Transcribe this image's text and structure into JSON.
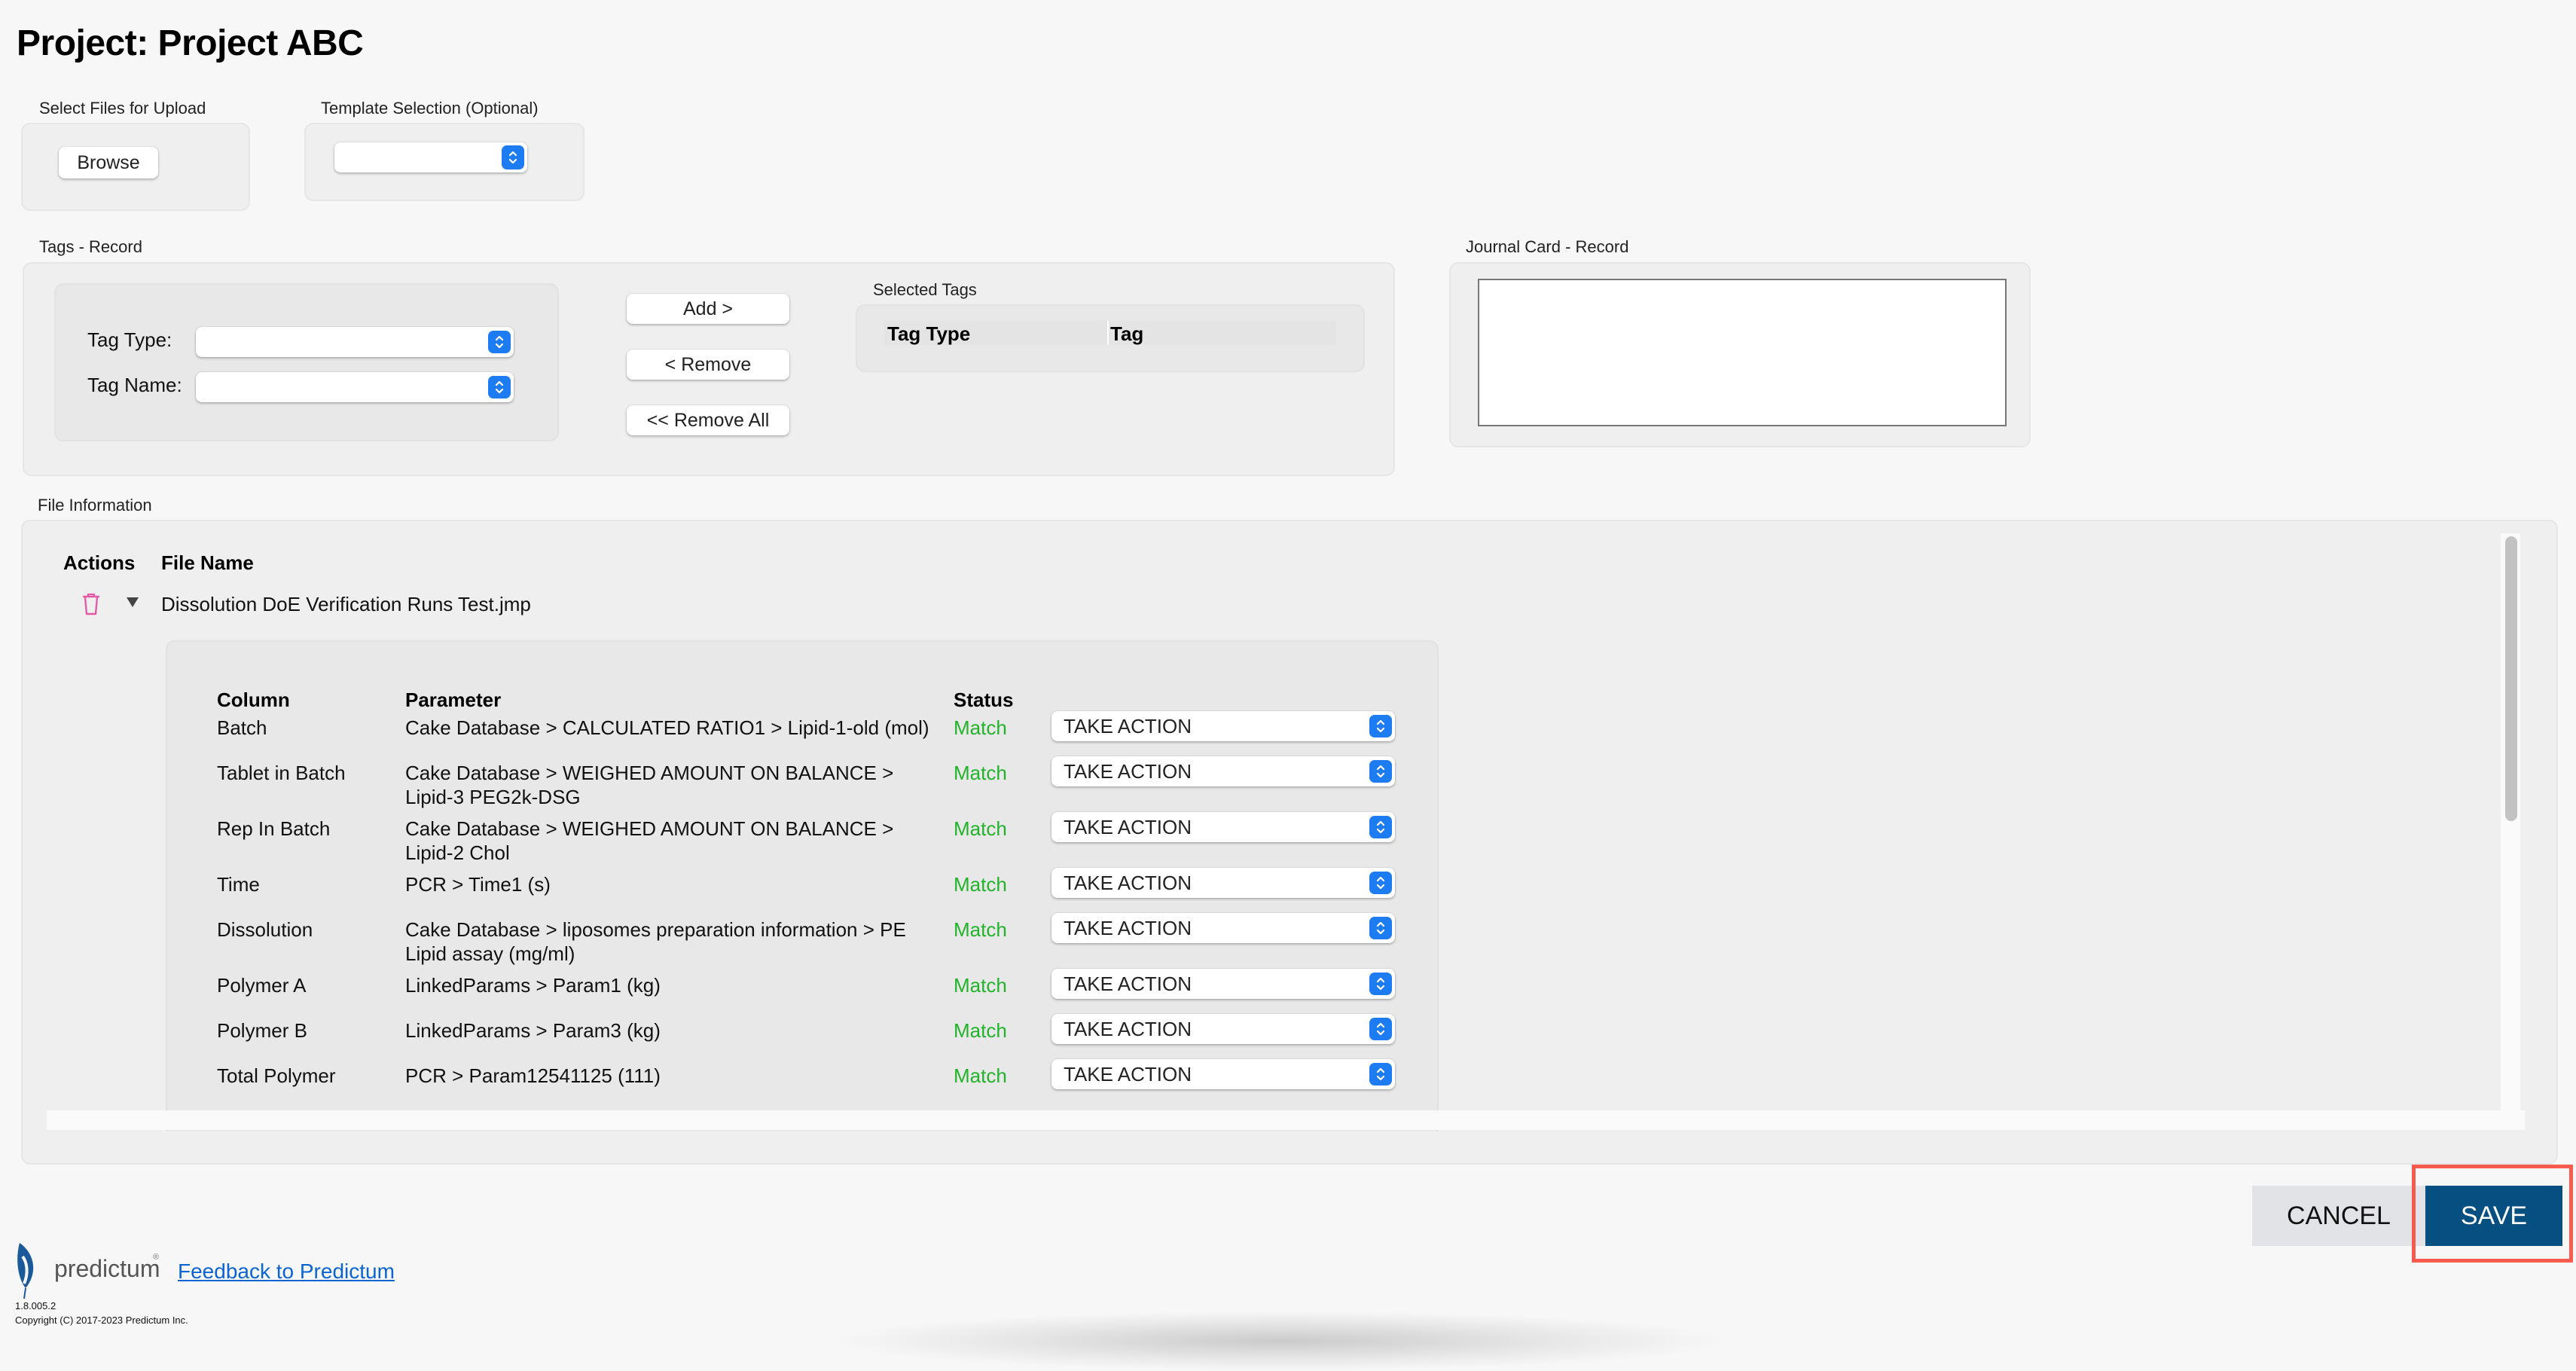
{
  "page": {
    "title": "Project: Project ABC"
  },
  "upload": {
    "label": "Select Files for Upload",
    "browse_label": "Browse"
  },
  "template": {
    "label": "Template Selection (Optional)",
    "selected": ""
  },
  "tags": {
    "label": "Tags - Record",
    "tag_type_label": "Tag Type:",
    "tag_type_value": "",
    "tag_name_label": "Tag Name:",
    "tag_name_value": "",
    "add_label": "Add >",
    "remove_label": "< Remove",
    "remove_all_label": "<< Remove All",
    "selected_label": "Selected Tags",
    "selected_headers": [
      "Tag Type",
      "Tag"
    ],
    "selected_rows": []
  },
  "journal": {
    "label": "Journal Card - Record",
    "text": ""
  },
  "file_info": {
    "label": "File Information",
    "headers": [
      "Actions",
      "File Name"
    ],
    "files": [
      {
        "name": "Dissolution DoE Verification Runs Test.jmp",
        "expanded": true,
        "mapping_headers": [
          "Column",
          "Parameter",
          "Status"
        ],
        "mappings": [
          {
            "column": "Batch",
            "parameter": "Cake Database > CALCULATED RATIO1 > Lipid-1-old (mol)",
            "status": "Match",
            "action": "TAKE ACTION"
          },
          {
            "column": "Tablet in Batch",
            "parameter": "Cake Database > WEIGHED AMOUNT ON BALANCE > Lipid-3 PEG2k-DSG",
            "status": "Match",
            "action": "TAKE ACTION"
          },
          {
            "column": "Rep In Batch",
            "parameter": "Cake Database > WEIGHED AMOUNT ON BALANCE > Lipid-2 Chol",
            "status": "Match",
            "action": "TAKE ACTION"
          },
          {
            "column": "Time",
            "parameter": "PCR  > Time1 (s)",
            "status": "Match",
            "action": "TAKE ACTION"
          },
          {
            "column": "Dissolution",
            "parameter": "Cake Database > liposomes preparation information > PE Lipid assay (mg/ml)",
            "status": "Match",
            "action": "TAKE ACTION"
          },
          {
            "column": "Polymer A",
            "parameter": "LinkedParams > Param1 (kg)",
            "status": "Match",
            "action": "TAKE ACTION"
          },
          {
            "column": "Polymer B",
            "parameter": "LinkedParams > Param3 (kg)",
            "status": "Match",
            "action": "TAKE ACTION"
          },
          {
            "column": "Total Polymer",
            "parameter": "PCR  > Param12541125 (111)",
            "status": "Match",
            "action": "TAKE ACTION"
          }
        ]
      }
    ]
  },
  "actions": {
    "cancel_label": "CANCEL",
    "save_label": "SAVE"
  },
  "footer": {
    "brand": "predictum",
    "feedback_link": "Feedback to Predictum",
    "version": "1.8.005.2",
    "copyright": "Copyright (C) 2017-2023 Predictum Inc."
  },
  "colors": {
    "accent": "#1e7cf2",
    "save": "#054f81",
    "match": "#22b32b",
    "highlight": "#f65b4d",
    "link": "#0c64d3",
    "trash": "#e35ba6"
  }
}
